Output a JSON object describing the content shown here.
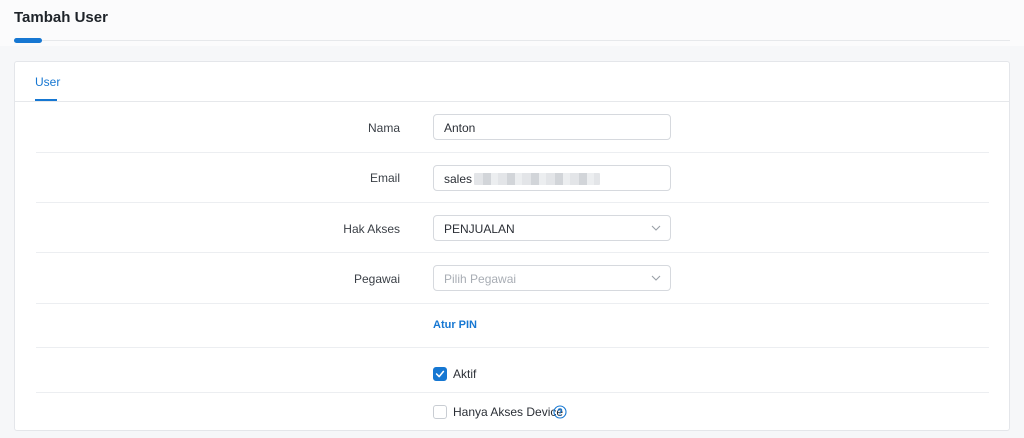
{
  "page": {
    "title": "Tambah User"
  },
  "tabs": [
    {
      "label": "User",
      "active": true
    }
  ],
  "form": {
    "nama": {
      "label": "Nama",
      "value": "Anton"
    },
    "email": {
      "label": "Email",
      "value": "sales"
    },
    "hak_akses": {
      "label": "Hak Akses",
      "value": "PENJUALAN"
    },
    "pegawai": {
      "label": "Pegawai",
      "placeholder": "Pilih Pegawai"
    },
    "atur_pin": {
      "label": "Atur PIN"
    },
    "aktif": {
      "label": "Aktif",
      "checked": true
    },
    "hanya_akses_device": {
      "label": "Hanya Akses Device",
      "checked": false
    }
  },
  "colors": {
    "accent": "#1677d2",
    "border": "#d6d9de",
    "text": "#2b2f36"
  },
  "icons": {
    "select": "chevron-down-icon",
    "checkbox": "checkmark-icon",
    "help": "question-circle-icon"
  }
}
